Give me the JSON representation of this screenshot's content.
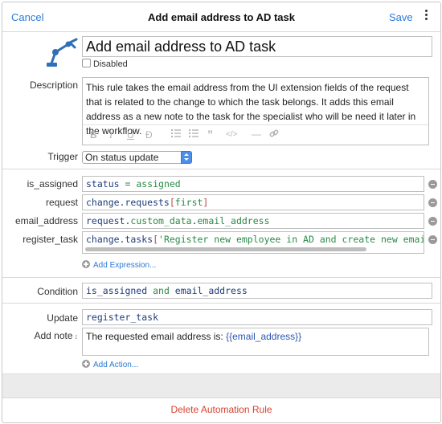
{
  "navbar": {
    "cancel_label": "Cancel",
    "title": "Add email address to AD task",
    "save_label": "Save",
    "more_icon": "more-vertical-icon"
  },
  "header": {
    "icon": "robot-arm-icon",
    "name_value": "Add email address to AD task",
    "disabled_label": "Disabled",
    "disabled_checked": false
  },
  "description": {
    "label": "Description",
    "text": "This rule takes the email address from the UI extension fields of the request that is related to the change to which the task belongs. It adds this email address as a new note to the task for the specialist who will be need it later in the workflow.",
    "toolbar": [
      "B",
      "I",
      "U",
      "S",
      "numbered-list",
      "bullet-list",
      "quote",
      "code",
      "horizontal-rule",
      "link"
    ]
  },
  "trigger": {
    "label": "Trigger",
    "selected": "On status update"
  },
  "expressions": {
    "items": [
      {
        "label": "is_assigned",
        "code_a": "status",
        "code_b": " = ",
        "code_c": "assigned"
      },
      {
        "label": "request",
        "code_a": "change.requests",
        "code_b": "[",
        "code_c": "first",
        "code_d": "]"
      },
      {
        "label": "email_address",
        "code_a": "request.",
        "code_b": "custom_data",
        "code_c": ".",
        "code_d": "email_address"
      },
      {
        "label": "register_task",
        "code_a": "change.tasks",
        "code_b": "[",
        "code_c": "'Register new employee in AD and create new email"
      }
    ],
    "add_label": "Add Expression..."
  },
  "condition": {
    "label": "Condition",
    "code_a": "is_assigned",
    "code_b": " and ",
    "code_c": "email_address"
  },
  "actions": {
    "update_label": "Update",
    "update_value": "register_task",
    "add_note_label": "Add note",
    "note_prefix": "The requested email address is: ",
    "note_var": "{{email_address}}",
    "add_label": "Add Action..."
  },
  "footer": {
    "delete_label": "Delete Automation Rule"
  },
  "colors": {
    "link": "#2b7ad6",
    "danger": "#d9412e",
    "icon": "#2f6fb8"
  }
}
